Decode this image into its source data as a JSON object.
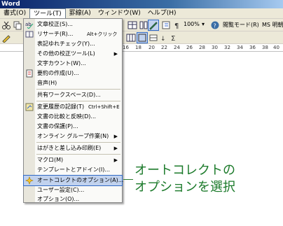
{
  "window": {
    "title": "Word"
  },
  "menubar": [
    {
      "label": "書式(O)",
      "active": false
    },
    {
      "label": "ツール(T)",
      "active": true
    },
    {
      "label": "罫線(A)",
      "active": false
    },
    {
      "label": "ウィンドウ(W)",
      "active": false
    },
    {
      "label": "ヘルプ(H)",
      "active": false
    }
  ],
  "toolbar": {
    "zoom": "100%",
    "reading_mode": "閲覧モード(R)",
    "font_name": "MS 明朝"
  },
  "ruler": {
    "numbers": [
      "16",
      "18",
      "20",
      "22",
      "24",
      "26",
      "28",
      "30",
      "32",
      "34",
      "36",
      "38",
      "40"
    ]
  },
  "tools_menu": {
    "items": [
      {
        "label": "文章校正(S)...",
        "shortcut": "",
        "submenu": false,
        "icon": "spellcheck-icon"
      },
      {
        "label": "リサーチ(R)...",
        "shortcut": "Alt+クリック",
        "submenu": false,
        "icon": "research-icon"
      },
      {
        "label": "表記ゆれチェック(Y)...",
        "shortcut": "",
        "submenu": false,
        "icon": ""
      },
      {
        "label": "その他の校正ツール(L)",
        "shortcut": "",
        "submenu": true,
        "icon": ""
      },
      {
        "label": "文字カウント(W)...",
        "shortcut": "",
        "submenu": false,
        "icon": ""
      },
      {
        "label": "要約の作成(U)...",
        "shortcut": "",
        "submenu": false,
        "icon": "summary-icon"
      },
      {
        "label": "音声(H)",
        "shortcut": "",
        "submenu": false,
        "icon": ""
      },
      {
        "label": "共有ワークスペース(D)...",
        "shortcut": "",
        "submenu": false,
        "icon": ""
      },
      {
        "label": "変更履歴の記録(T)",
        "shortcut": "Ctrl+Shift+E",
        "submenu": false,
        "icon": "track-changes-icon"
      },
      {
        "label": "文書の比較と反映(D)...",
        "shortcut": "",
        "submenu": false,
        "icon": ""
      },
      {
        "label": "文書の保護(P)...",
        "shortcut": "",
        "submenu": false,
        "icon": ""
      },
      {
        "label": "オンライン グループ作業(N)",
        "shortcut": "",
        "submenu": true,
        "icon": ""
      },
      {
        "label": "はがきと差し込み印刷(E)",
        "shortcut": "",
        "submenu": true,
        "icon": ""
      },
      {
        "label": "マクロ(M)",
        "shortcut": "",
        "submenu": true,
        "icon": ""
      },
      {
        "label": "テンプレートとアドイン(I)...",
        "shortcut": "",
        "submenu": false,
        "icon": ""
      },
      {
        "label": "オートコレクトのオプション(A)...",
        "shortcut": "",
        "submenu": false,
        "icon": "autocorrect-icon"
      },
      {
        "label": "ユーザー設定(C)...",
        "shortcut": "",
        "submenu": false,
        "icon": ""
      },
      {
        "label": "オプション(O)...",
        "shortcut": "",
        "submenu": false,
        "icon": ""
      }
    ],
    "highlighted_index": 15
  },
  "annotation": {
    "line1": "オートコレクトの",
    "line2": "オプションを選択",
    "color": "#1b7a2a"
  }
}
